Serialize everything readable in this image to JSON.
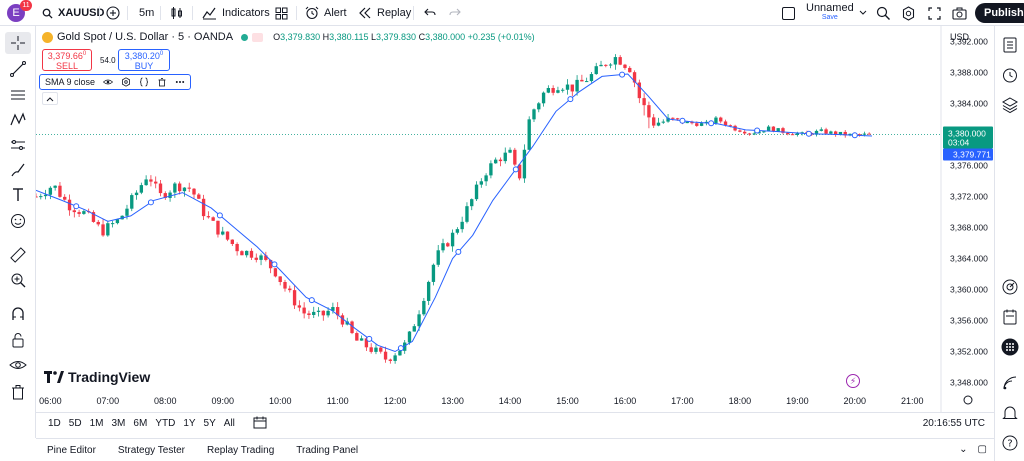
{
  "topbar": {
    "avatar_letter": "E",
    "notifications": "11",
    "symbol": "XAUUSD",
    "interval": "5m",
    "indicators": "Indicators",
    "alert": "Alert",
    "replay": "Replay",
    "layout_name": "Unnamed",
    "save": "Save",
    "publish": "Publish"
  },
  "legend": {
    "title": "Gold Spot / U.S. Dollar · 5 · OANDA",
    "open": "3,379.830",
    "high": "3,380.115",
    "low": "3,379.830",
    "close": "3,380.000",
    "change": "+0.235 (+0.01%)",
    "sell_price": "3,379.66",
    "sell_sup": "0",
    "sell_label": "SELL",
    "spread": "54.0",
    "buy_price": "3,380.20",
    "buy_sup": "0",
    "buy_label": "BUY",
    "sma_label": "SMA 9 close"
  },
  "price_axis": {
    "currency": "USD",
    "ticks": [
      "3,392.000",
      "3,388.000",
      "3,384.000",
      "3,380.000",
      "3,376.000",
      "3,372.000",
      "3,368.000",
      "3,364.000",
      "3,360.000",
      "3,356.000",
      "3,352.000",
      "3,348.000"
    ],
    "last_price": "3,380.000",
    "countdown": "03:04",
    "sma_price": "3,379.771"
  },
  "time_axis": {
    "labels": [
      "06:00",
      "07:00",
      "08:00",
      "09:00",
      "10:00",
      "11:00",
      "12:00",
      "13:00",
      "14:00",
      "15:00",
      "16:00",
      "17:00",
      "18:00",
      "19:00",
      "20:00",
      "21:00"
    ]
  },
  "chart_data": {
    "type": "candlestick",
    "symbol": "XAUUSD",
    "interval": "5m",
    "ylim": [
      3346,
      3394
    ],
    "x_range_hours": [
      5.75,
      21.5
    ],
    "last_price": 3380.0,
    "sma9_last": 3379.771,
    "price_path": [
      {
        "t": 5.75,
        "p": 3372.0
      },
      {
        "t": 6.05,
        "p": 3373.5
      },
      {
        "t": 6.3,
        "p": 3371.0
      },
      {
        "t": 6.6,
        "p": 3369.8
      },
      {
        "t": 6.9,
        "p": 3367.5
      },
      {
        "t": 7.2,
        "p": 3369.0
      },
      {
        "t": 7.5,
        "p": 3372.5
      },
      {
        "t": 7.7,
        "p": 3375.0
      },
      {
        "t": 7.9,
        "p": 3372.0
      },
      {
        "t": 8.2,
        "p": 3373.5
      },
      {
        "t": 8.45,
        "p": 3373.0
      },
      {
        "t": 8.7,
        "p": 3369.5
      },
      {
        "t": 9.0,
        "p": 3367.0
      },
      {
        "t": 9.3,
        "p": 3365.0
      },
      {
        "t": 9.6,
        "p": 3364.5
      },
      {
        "t": 9.9,
        "p": 3362.5
      },
      {
        "t": 10.1,
        "p": 3360.0
      },
      {
        "t": 10.4,
        "p": 3357.0
      },
      {
        "t": 10.7,
        "p": 3356.5
      },
      {
        "t": 10.9,
        "p": 3357.5
      },
      {
        "t": 11.1,
        "p": 3356.0
      },
      {
        "t": 11.3,
        "p": 3353.5
      },
      {
        "t": 11.55,
        "p": 3352.5
      },
      {
        "t": 11.85,
        "p": 3351.0
      },
      {
        "t": 12.2,
        "p": 3353.0
      },
      {
        "t": 12.45,
        "p": 3358.0
      },
      {
        "t": 12.7,
        "p": 3364.0
      },
      {
        "t": 13.0,
        "p": 3367.0
      },
      {
        "t": 13.3,
        "p": 3371.0
      },
      {
        "t": 13.55,
        "p": 3375.0
      },
      {
        "t": 13.8,
        "p": 3377.0
      },
      {
        "t": 14.0,
        "p": 3377.5
      },
      {
        "t": 14.15,
        "p": 3374.0
      },
      {
        "t": 14.35,
        "p": 3382.5
      },
      {
        "t": 14.6,
        "p": 3385.5
      },
      {
        "t": 14.85,
        "p": 3386.5
      },
      {
        "t": 15.1,
        "p": 3386.0
      },
      {
        "t": 15.4,
        "p": 3387.5
      },
      {
        "t": 15.7,
        "p": 3389.5
      },
      {
        "t": 15.85,
        "p": 3390.0
      },
      {
        "t": 16.1,
        "p": 3388.5
      },
      {
        "t": 16.3,
        "p": 3383.5
      },
      {
        "t": 16.5,
        "p": 3381.5
      },
      {
        "t": 16.8,
        "p": 3381.8
      },
      {
        "t": 17.1,
        "p": 3381.5
      },
      {
        "t": 17.4,
        "p": 3381.3
      },
      {
        "t": 17.6,
        "p": 3382.0
      },
      {
        "t": 17.9,
        "p": 3380.8
      },
      {
        "t": 18.2,
        "p": 3380.2
      },
      {
        "t": 18.5,
        "p": 3380.8
      },
      {
        "t": 18.8,
        "p": 3380.3
      },
      {
        "t": 19.1,
        "p": 3380.0
      },
      {
        "t": 19.4,
        "p": 3380.4
      },
      {
        "t": 19.7,
        "p": 3380.1
      },
      {
        "t": 19.95,
        "p": 3379.9
      },
      {
        "t": 20.3,
        "p": 3380.0
      }
    ],
    "sma9_path": [
      {
        "t": 5.75,
        "p": 3372.8
      },
      {
        "t": 6.2,
        "p": 3371.5
      },
      {
        "t": 6.6,
        "p": 3370.3
      },
      {
        "t": 7.0,
        "p": 3368.8
      },
      {
        "t": 7.4,
        "p": 3369.5
      },
      {
        "t": 7.8,
        "p": 3371.5
      },
      {
        "t": 8.3,
        "p": 3372.5
      },
      {
        "t": 8.8,
        "p": 3370.5
      },
      {
        "t": 9.2,
        "p": 3368.0
      },
      {
        "t": 9.6,
        "p": 3365.5
      },
      {
        "t": 10.0,
        "p": 3362.5
      },
      {
        "t": 10.45,
        "p": 3359.0
      },
      {
        "t": 10.9,
        "p": 3357.3
      },
      {
        "t": 11.3,
        "p": 3355.0
      },
      {
        "t": 11.7,
        "p": 3352.8
      },
      {
        "t": 12.0,
        "p": 3352.0
      },
      {
        "t": 12.3,
        "p": 3353.3
      },
      {
        "t": 12.7,
        "p": 3359.0
      },
      {
        "t": 13.0,
        "p": 3364.0
      },
      {
        "t": 13.35,
        "p": 3367.0
      },
      {
        "t": 13.7,
        "p": 3371.5
      },
      {
        "t": 14.0,
        "p": 3374.5
      },
      {
        "t": 14.4,
        "p": 3378.5
      },
      {
        "t": 14.8,
        "p": 3383.0
      },
      {
        "t": 15.2,
        "p": 3385.5
      },
      {
        "t": 15.6,
        "p": 3387.5
      },
      {
        "t": 16.05,
        "p": 3387.8
      },
      {
        "t": 16.4,
        "p": 3385.0
      },
      {
        "t": 16.75,
        "p": 3382.0
      },
      {
        "t": 17.2,
        "p": 3381.6
      },
      {
        "t": 17.6,
        "p": 3381.4
      },
      {
        "t": 18.1,
        "p": 3380.6
      },
      {
        "t": 18.6,
        "p": 3380.4
      },
      {
        "t": 19.2,
        "p": 3380.1
      },
      {
        "t": 19.7,
        "p": 3380.0
      },
      {
        "t": 20.3,
        "p": 3379.8
      }
    ],
    "sma_markers_t": [
      6.45,
      7.75,
      8.95,
      9.9,
      10.55,
      11.55,
      12.1,
      13.1,
      14.1,
      15.05,
      15.95,
      17.0,
      17.5,
      18.3,
      19.2,
      20.0
    ]
  },
  "range_bar": {
    "ranges": [
      "1D",
      "5D",
      "1M",
      "3M",
      "6M",
      "YTD",
      "1Y",
      "5Y",
      "All"
    ],
    "clock": "20:16:55 UTC"
  },
  "panel_bar": {
    "tabs": [
      "Pine Editor",
      "Strategy Tester",
      "Replay Trading",
      "Trading Panel"
    ]
  },
  "brand": {
    "logo_text": "TradingView"
  },
  "colors": {
    "up": "#089981",
    "down": "#f23645",
    "sma": "#2962ff",
    "last_price_bg": "#089981",
    "sma_price_bg": "#2962ff"
  }
}
